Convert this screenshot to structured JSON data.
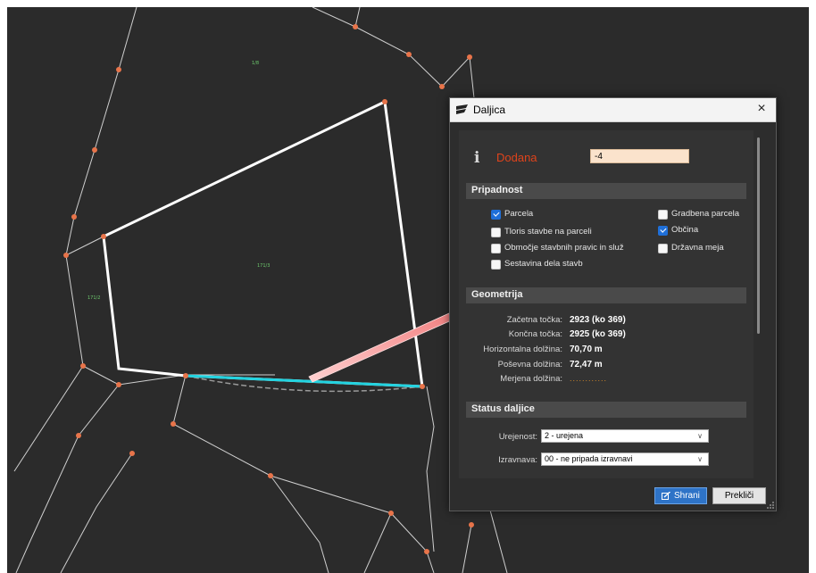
{
  "map": {
    "labels": [
      "1/8",
      "171/2",
      "171/3"
    ],
    "colors": {
      "background": "#2b2b2b",
      "lines": "#d9d9d9",
      "vertex": "#e8744a",
      "parcel": "#ffffff",
      "selected_edge": "#22d3e0",
      "arrow": "#e02020"
    }
  },
  "dialog": {
    "title": "Daljica",
    "close_symbol": "×",
    "info_icon": "i",
    "status_label": "Dodana",
    "id_value": "-4",
    "pripadnost": {
      "title": "Pripadnost",
      "items": [
        {
          "label": "Parcela",
          "checked": true
        },
        {
          "label": "Tloris stavbe na parceli",
          "checked": false
        },
        {
          "label": "Območje stavbnih pravic in služ",
          "checked": false
        },
        {
          "label": "Sestavina dela stavb",
          "checked": false
        },
        {
          "label": "Gradbena parcela",
          "checked": false
        },
        {
          "label": "Občina",
          "checked": true
        },
        {
          "label": "Državna meja",
          "checked": false
        }
      ]
    },
    "geometrija": {
      "title": "Geometrija",
      "start_label": "Začetna točka:",
      "start_value": "2923  (ko 369)",
      "end_label": "Končna točka:",
      "end_value": "2925  (ko 369)",
      "horiz_label": "Horizontalna dolžina:",
      "horiz_value": "70,70 m",
      "slope_label": "Poševna dolžina:",
      "slope_value": "72,47 m",
      "measured_label": "Merjena dolžina:",
      "measured_value": "............"
    },
    "status": {
      "title": "Status daljice",
      "urejenost_label": "Urejenost:",
      "urejenost_value": "2 - urejena",
      "izravnava_label": "Izravnava:",
      "izravnava_value": "00 - ne pripada izravnavi"
    },
    "save_label": "Shrani",
    "cancel_label": "Prekliči"
  }
}
